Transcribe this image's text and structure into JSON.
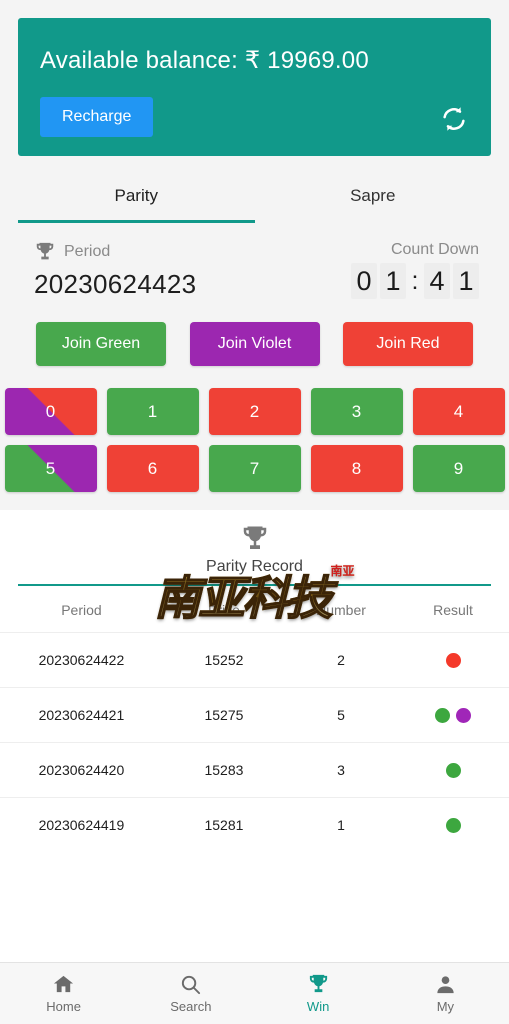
{
  "header": {
    "balance_label": "Available balance: ₹ 19969.00",
    "recharge_label": "Recharge",
    "refresh_icon": "refresh-icon",
    "bg_color": "#11998a",
    "recharge_color": "#2196f3"
  },
  "tabs": [
    {
      "label": "Parity",
      "active": true
    },
    {
      "label": "Sapre",
      "active": false
    }
  ],
  "period": {
    "icon": "trophy-icon",
    "label": "Period",
    "value": "20230624423",
    "countdown_label": "Count Down",
    "countdown": {
      "d1": "0",
      "d2": "1",
      "sep": ":",
      "d3": "4",
      "d4": "1"
    }
  },
  "join_buttons": [
    {
      "label": "Join Green",
      "color": "#48a84d"
    },
    {
      "label": "Join Violet",
      "color": "#9c27b0"
    },
    {
      "label": "Join Red",
      "color": "#ef4136"
    }
  ],
  "numbers": [
    {
      "label": "0",
      "style": "split-vr"
    },
    {
      "label": "1",
      "style": "c-green"
    },
    {
      "label": "2",
      "style": "c-red"
    },
    {
      "label": "3",
      "style": "c-green"
    },
    {
      "label": "4",
      "style": "c-red"
    },
    {
      "label": "5",
      "style": "split-vg"
    },
    {
      "label": "6",
      "style": "c-red"
    },
    {
      "label": "7",
      "style": "c-green"
    },
    {
      "label": "8",
      "style": "c-red"
    },
    {
      "label": "9",
      "style": "c-green"
    }
  ],
  "record": {
    "icon": "trophy-icon",
    "title": "Parity Record",
    "watermark_text": "南亚科技",
    "watermark_seal": "南亚",
    "columns": [
      "Period",
      "Price",
      "Number",
      "Result"
    ],
    "rows": [
      {
        "period": "20230624422",
        "price": "15252",
        "number": "2",
        "number_color": "red",
        "dots": [
          "red"
        ]
      },
      {
        "period": "20230624421",
        "price": "15275",
        "number": "5",
        "number_color": "green",
        "dots": [
          "green",
          "violet"
        ]
      },
      {
        "period": "20230624420",
        "price": "15283",
        "number": "3",
        "number_color": "green",
        "dots": [
          "green"
        ]
      },
      {
        "period": "20230624419",
        "price": "15281",
        "number": "1",
        "number_color": "green",
        "dots": [
          "green"
        ]
      }
    ]
  },
  "bottom_nav": [
    {
      "label": "Home",
      "icon": "home-icon",
      "active": false
    },
    {
      "label": "Search",
      "icon": "search-icon",
      "active": false
    },
    {
      "label": "Win",
      "icon": "trophy-icon",
      "active": true
    },
    {
      "label": "My",
      "icon": "person-icon",
      "active": false
    }
  ]
}
